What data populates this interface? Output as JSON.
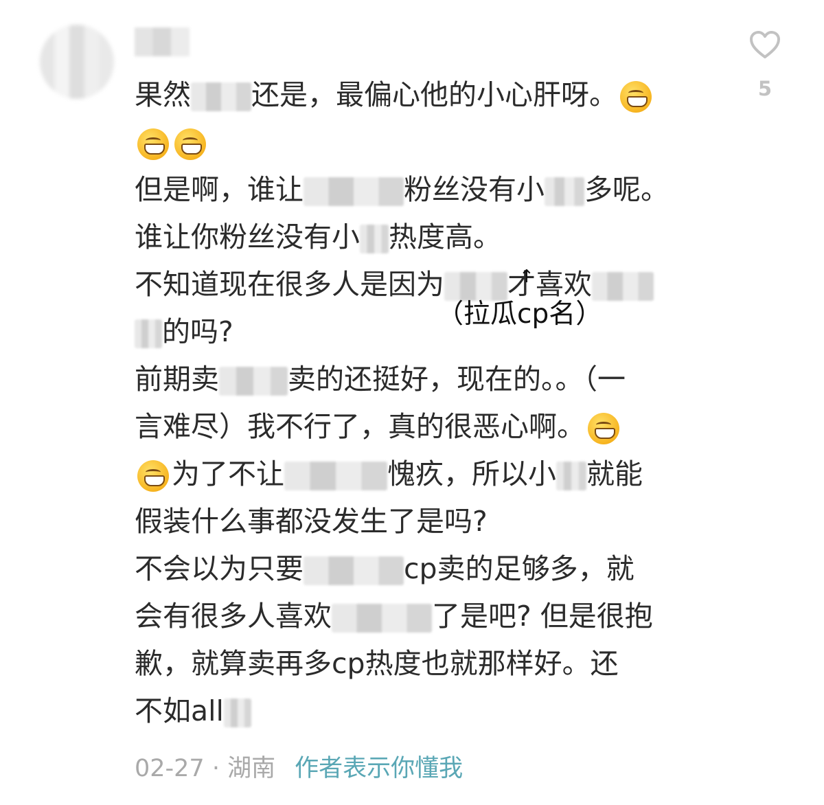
{
  "comment": {
    "likes": "5",
    "lines": [
      [
        "果然",
        "还是，最偏心他的小心肝呀。"
      ],
      [],
      [
        "但是啊，谁让",
        "粉丝没有小",
        "多呢。"
      ],
      [
        "谁让你粉丝没有小",
        "热度高。"
      ],
      [
        "不知道现在很多人是因为",
        "才喜欢"
      ],
      [
        "的吗?"
      ],
      [
        "前期卖",
        "卖的还挺好，现在的。。（一"
      ],
      [
        "言难尽）我不行了，真的很恶心啊。"
      ],
      [
        "为了不让",
        "愧疚，所以小",
        "就能"
      ],
      [
        "假装什么事都没发生了是吗?"
      ],
      [
        "不会以为只要",
        "cp卖的足够多，就"
      ],
      [
        "会有很多人喜欢",
        "了是吧? 但是很抱"
      ],
      [
        "歉，就算卖再多cp热度也就那样好。还"
      ],
      [
        "不如all"
      ]
    ],
    "annotation": "（拉瓜cp名）",
    "annotation_arrow": "↑",
    "date": "02-27",
    "location": "湖南",
    "author_tag": "作者表示你懂我"
  },
  "icons": {
    "like": "heart-outline-icon",
    "emoji_grin": "grinning-face-icon",
    "emoji_sweat": "grinning-sweat-icon"
  },
  "colors": {
    "text": "#2b2b2b",
    "meta": "#a9a9a9",
    "author_tag": "#5aa7b5",
    "like_icon": "#c2c2c2"
  }
}
